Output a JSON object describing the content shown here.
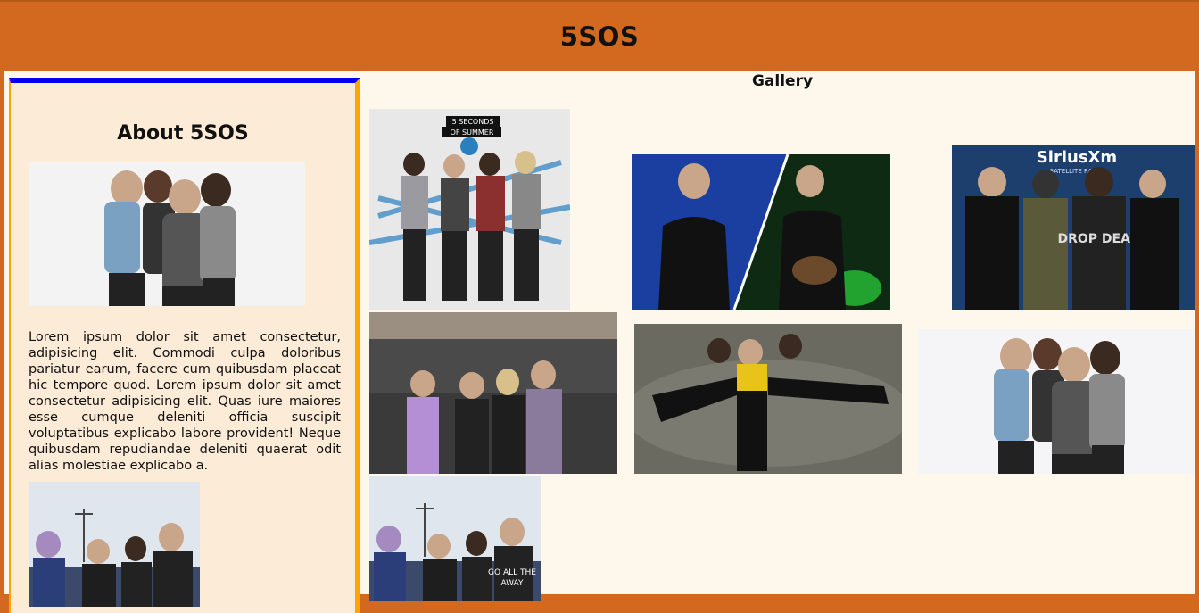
{
  "header": {
    "title": "5SOS"
  },
  "sidebar": {
    "heading": "About 5SOS",
    "paragraph": "Lorem ipsum dolor sit amet consectetur, adipisicing elit. Commodi culpa doloribus pariatur earum, facere cum quibusdam placeat hic tempore quod. Lorem ipsum dolor sit amet consectetur adipisicing elit. Quas iure maiores esse cumque deleniti officia suscipit voluptatibus explicabo labore provident! Neque quibusdam repudiandae deleniti quaerat odit alias molestiae explicabo a."
  },
  "gallery": {
    "title": "Gallery",
    "album_cover_text": [
      "5 SECONDS",
      "OF SUMMER"
    ],
    "siriusxm_logo_text": "SiriusXm",
    "siriusxm_subtitle": "SATELLITE RADIO",
    "shirt_text": [
      "GO ALL THE",
      "AWAY"
    ],
    "drop_dead_text": "DROP DEAD"
  },
  "colors": {
    "header_bg": "#d2691e",
    "page_bg": "#fdf7ec",
    "sidebar_bg": "#fcebd7",
    "sidebar_border_top": "#0000ee",
    "sidebar_border_side": "#ffa500"
  }
}
